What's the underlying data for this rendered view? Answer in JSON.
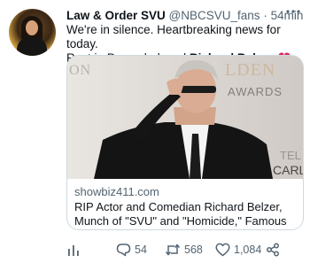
{
  "tweet": {
    "author_name": "Law & Order SVU",
    "handle": "@NBCSVU_fans",
    "separator": "·",
    "time": "54min",
    "line1": "We're in silence. Heartbreaking news for today.",
    "line2_prefix": "Rest in Peace beloved",
    "line2_bold": "Richard Belzer",
    "emoji_icon": "broken-heart-icon"
  },
  "card": {
    "domain": "showbiz411.com",
    "title": "RIP Actor and Comedian Richard Belzer, Munch of \"SVU\" and \"Homicide,\" Famous for...",
    "image_text_left": "ON",
    "image_text_right_top": "LDEN",
    "image_text_right_mid": "AWARDS",
    "image_text_right_bottom1": "TEL",
    "image_text_right_bottom2": "CARL"
  },
  "actions": {
    "replies": "54",
    "retweets": "568",
    "likes": "1,084"
  },
  "colors": {
    "text": "#0f1419",
    "secondary": "#536471",
    "border": "#cfd9de",
    "heart": "#e0245e"
  }
}
